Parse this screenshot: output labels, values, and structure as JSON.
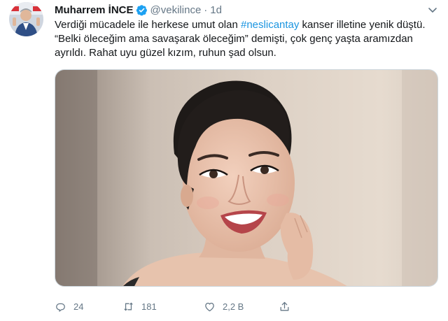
{
  "tweet": {
    "author_name": "Muharrem İNCE",
    "handle": "@vekilince",
    "separator": "·",
    "time": "1d",
    "text_before": "Verdiği mücadele ile herkese umut olan ",
    "hashtag": "#neslicantay",
    "text_after": " kanser illetine yenik düştü. “Belki öleceğim ama savaşarak öleceğim” demişti, çok genç yaşta aramızdan ayrıldı. Rahat uyu güzel kızım, ruhun şad olsun.",
    "replies": "24",
    "retweets": "181",
    "likes": "2,2 B"
  },
  "colors": {
    "text": "#14171a",
    "secondary": "#657786",
    "link": "#1b95e0",
    "verified": "#1da1f2"
  },
  "icons": {
    "verified": "verified-badge-icon",
    "more": "chevron-down-icon",
    "reply": "reply-icon",
    "retweet": "retweet-icon",
    "like": "heart-icon",
    "share": "share-icon"
  }
}
